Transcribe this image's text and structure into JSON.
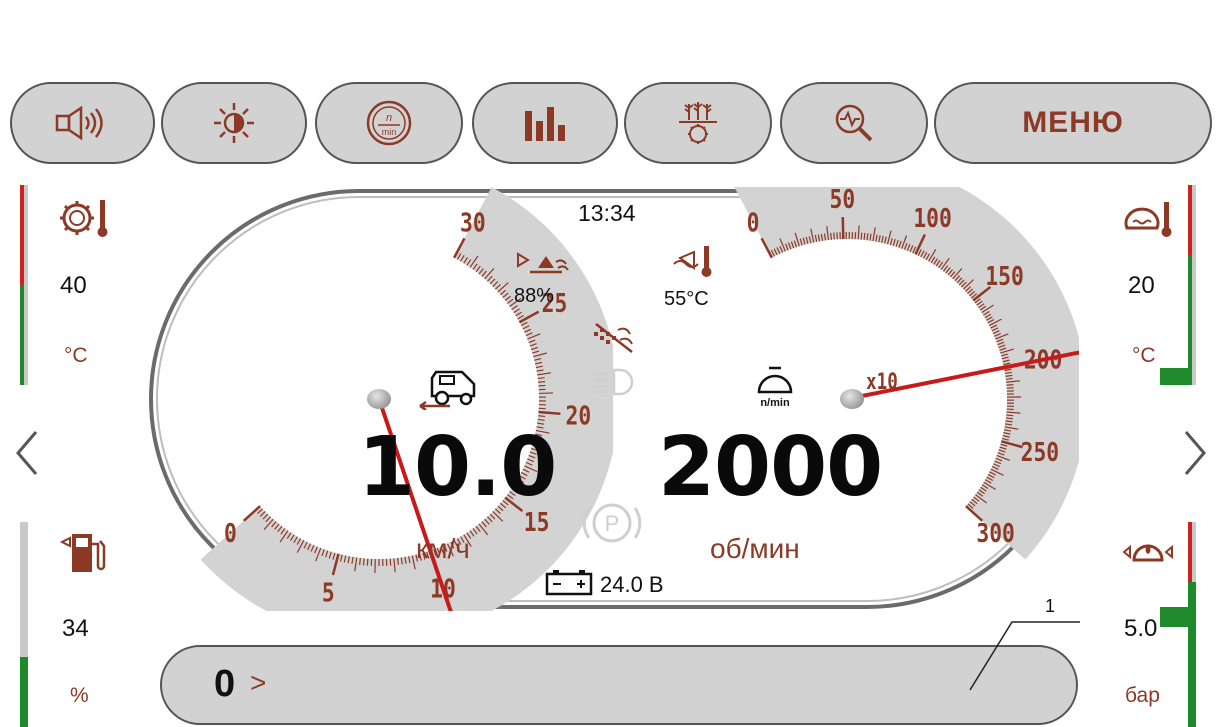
{
  "toolbar": {
    "buttons": [
      {
        "name": "volume-button",
        "icon": "speaker-icon"
      },
      {
        "name": "brightness-button",
        "icon": "sun-icon"
      },
      {
        "name": "rpm-button",
        "icon": "rpm-icon",
        "icon_text_top": "n",
        "icon_text_bottom": "min"
      },
      {
        "name": "statistics-button",
        "icon": "bar-chart-icon"
      },
      {
        "name": "harvest-button",
        "icon": "grain-gear-icon"
      },
      {
        "name": "diagnostics-button",
        "icon": "diagnostic-magnifier-icon"
      }
    ],
    "menu_label": "МЕНЮ"
  },
  "left_panel": {
    "top": {
      "icon": "engine-coolant-temp-icon",
      "value": "40",
      "unit": "°C"
    },
    "bottom": {
      "icon": "fuel-pump-icon",
      "value": "34",
      "unit": "%"
    }
  },
  "right_panel": {
    "top": {
      "icon": "oil-temperature-icon",
      "value": "20",
      "unit": "°C"
    },
    "bottom": {
      "icon": "oil-pressure-icon",
      "value": "5.0",
      "unit": "бар"
    }
  },
  "speed_gauge": {
    "ticks": [
      "0",
      "5",
      "10",
      "15",
      "20",
      "25",
      "30"
    ],
    "value": 10,
    "display": "10.0",
    "unit": "км/ч"
  },
  "rpm_gauge": {
    "ticks": [
      "0",
      "50",
      "100",
      "150",
      "200",
      "250",
      "300"
    ],
    "multiplier": "x10",
    "value": 200,
    "display": "2000",
    "unit": "об/мин",
    "icon_label": "n/min"
  },
  "center": {
    "clock": "13:34",
    "fill_percent": "88%",
    "temperature": "55°C",
    "battery": "24.0 В",
    "parking_label": "P"
  },
  "bottom": {
    "trip_value": "0",
    "trip_arrow": ">",
    "callout": "1"
  },
  "colors": {
    "accent": "#8c3a26",
    "needle": "#c81a1a",
    "panel": "#d2d2d2",
    "green": "#1f8a2c",
    "red": "#d02020"
  }
}
